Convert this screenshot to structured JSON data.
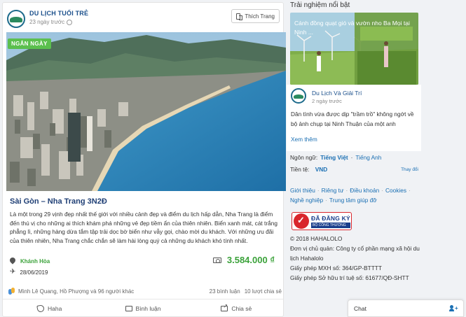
{
  "post": {
    "page_name": "DU LỊCH TUỔI TRẺ",
    "time": "23 ngày trước",
    "like_page_label": "Thích Trang",
    "badge": "NGẮN NGÀY",
    "title": "Sài Gòn – Nha Trang 3N2Đ",
    "description": "Là một trong 29 vịnh đẹp nhất thế giới với nhiều cảnh đẹp và điểm du lịch hấp dẫn, Nha Trang là điểm đến thú vị cho những ai thích khám phá những vẻ đẹp tiềm ẩn của thiên nhiên. Biển xanh mát, cát trắng phẳng lì, những hàng dừa tắm tập trải dọc bờ biển như vẫy gọi, chào mời du khách. Với những ưu đãi của thiên nhiên, Nha Trang chắc chắn sẽ làm hài lòng quý cả những du khách khó tính nhất.",
    "location": "Khánh Hòa",
    "date": "28/06/2019",
    "price": "3.584.000 ₫",
    "reactors": "Minh Lê Quang, Hồ Phượng và 96 người khác",
    "comments": "23 bình luận",
    "shares": "10 lượt chia sẻ",
    "actions": {
      "haha": "Haha",
      "comment": "Bình luận",
      "share": "Chia sẻ"
    }
  },
  "sidebar": {
    "title": "Trải nghiệm nổi bật",
    "featured": {
      "caption": "Cánh đồng quạt gió và vườn nho Ba Mọi tại Ninh ...",
      "page_name": "Du Lịch Và Giải Trí",
      "time": "2 ngày trước",
      "text": "Dân tình vừa được dịp \"trầm trồ\" không ngớt về bộ ảnh chụp tại Ninh Thuận của một anh",
      "more": "Xem thêm"
    },
    "language": {
      "label": "Ngôn ngữ:",
      "current": "Tiếng Việt",
      "other": "Tiếng Anh"
    },
    "currency": {
      "label": "Tiền tệ:",
      "value": "VND",
      "change": "Thay đổi"
    },
    "links": {
      "intro": "Giới thiệu",
      "privacy": "Riêng tư",
      "terms": "Điều khoản",
      "cookies": "Cookies",
      "careers": "Nghề nghiệp",
      "help": "Trung tâm giúp đỡ"
    },
    "registered": {
      "big": "ĐÃ ĐĂNG KÝ",
      "small": "BỘ CÔNG THƯƠNG"
    },
    "footer": {
      "copyright": "© 2018 HAHALOLO",
      "owner": "Đơn vị chủ quản: Công ty cổ phần mạng xã hội du lịch Hahalolo",
      "license1": "Giấy phép MXH số: 364/GP-BTTTT",
      "license2": "Giấy phép Sở hữu trí tuệ số: 61677/QĐ-SHTT"
    }
  },
  "chat": {
    "label": "Chat"
  },
  "colors": {
    "brand_blue": "#1a4f8b",
    "green": "#3ba23a",
    "link": "#1a6fb3",
    "badge": "#5bbf4e"
  }
}
